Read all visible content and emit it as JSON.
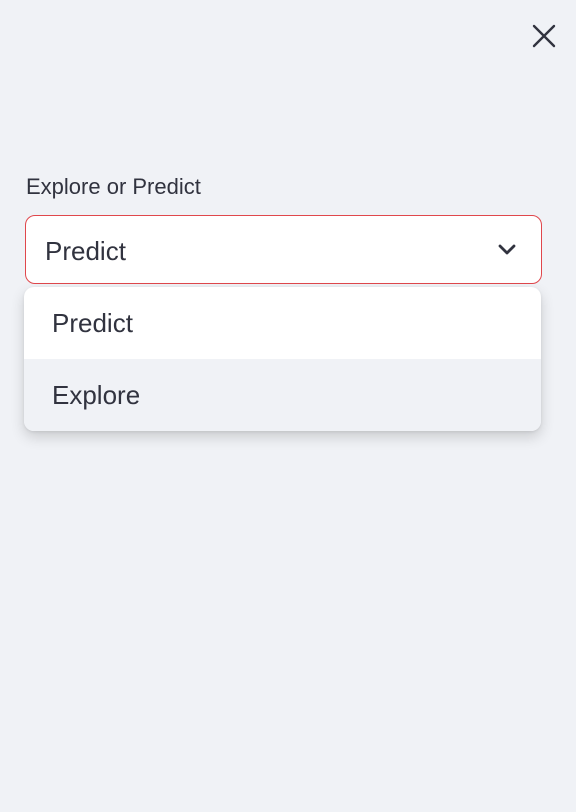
{
  "close_button": {
    "icon": "close-icon"
  },
  "select": {
    "label": "Explore or Predict",
    "value": "Predict",
    "border_color": "#e0474c",
    "icon": "chevron-down-icon"
  },
  "dropdown": {
    "options": [
      {
        "label": "Predict",
        "highlighted": false
      },
      {
        "label": "Explore",
        "highlighted": true
      }
    ]
  },
  "colors": {
    "background": "#f0f2f6",
    "text": "#31333f",
    "accent": "#e0474c"
  }
}
